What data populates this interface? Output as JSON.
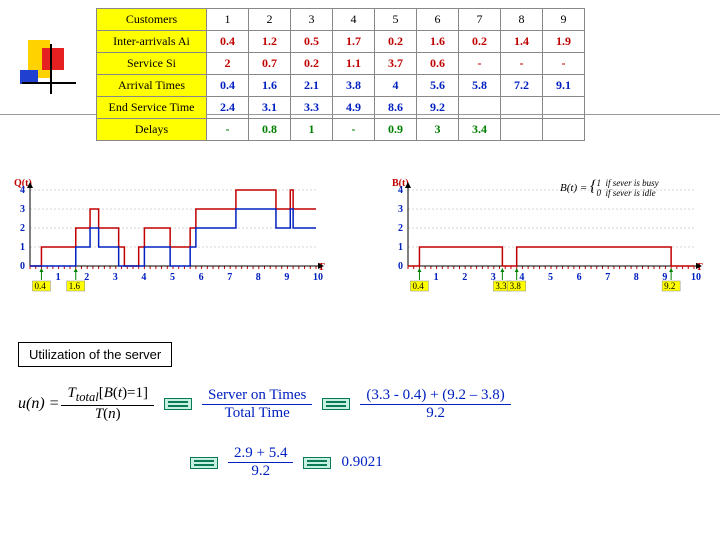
{
  "table": {
    "rows": [
      {
        "h": "Customers",
        "cls": "",
        "v": [
          "1",
          "2",
          "3",
          "4",
          "5",
          "6",
          "7",
          "8",
          "9"
        ]
      },
      {
        "h": "Inter-arrivals Ai",
        "cls": "red",
        "v": [
          "0.4",
          "1.2",
          "0.5",
          "1.7",
          "0.2",
          "1.6",
          "0.2",
          "1.4",
          "1.9"
        ]
      },
      {
        "h": "Service Si",
        "cls": "red",
        "v": [
          "2",
          "0.7",
          "0.2",
          "1.1",
          "3.7",
          "0.6",
          "-",
          "-",
          "-"
        ]
      },
      {
        "h": "Arrival Times",
        "cls": "blue",
        "v": [
          "0.4",
          "1.6",
          "2.1",
          "3.8",
          "4",
          "5.6",
          "5.8",
          "7.2",
          "9.1"
        ]
      },
      {
        "h": "End Service Time",
        "cls": "blue",
        "v": [
          "2.4",
          "3.1",
          "3.3",
          "4.9",
          "8.6",
          "9.2",
          "",
          "",
          ""
        ]
      },
      {
        "h": "Delays",
        "cls": "grn",
        "v": [
          "-",
          "0.8",
          "1",
          "-",
          "0.9",
          "3",
          "3.4",
          "",
          ""
        ]
      }
    ]
  },
  "chart_data": [
    {
      "type": "line",
      "title": "Q(t)",
      "xlabel": "T",
      "ylim": [
        0,
        4
      ],
      "xlim": [
        0,
        10
      ],
      "annotations": [
        "0.4",
        "1.6"
      ],
      "series": [
        {
          "name": "red",
          "color": "#c00000",
          "points": [
            [
              0,
              0
            ],
            [
              0.4,
              0
            ],
            [
              0.4,
              1
            ],
            [
              1.6,
              1
            ],
            [
              1.6,
              2
            ],
            [
              2.1,
              2
            ],
            [
              2.1,
              3
            ],
            [
              2.4,
              3
            ],
            [
              2.4,
              2
            ],
            [
              3.1,
              2
            ],
            [
              3.1,
              1
            ],
            [
              3.3,
              1
            ],
            [
              3.3,
              0
            ],
            [
              3.8,
              0
            ],
            [
              3.8,
              1
            ],
            [
              4,
              1
            ],
            [
              4,
              2
            ],
            [
              4.9,
              2
            ],
            [
              4.9,
              1
            ],
            [
              5.6,
              1
            ],
            [
              5.6,
              2
            ],
            [
              5.8,
              2
            ],
            [
              5.8,
              3
            ],
            [
              7.2,
              3
            ],
            [
              7.2,
              4
            ],
            [
              8.6,
              4
            ],
            [
              8.6,
              3
            ],
            [
              9.1,
              3
            ],
            [
              9.1,
              4
            ],
            [
              9.2,
              4
            ],
            [
              9.2,
              3
            ],
            [
              10,
              3
            ]
          ]
        },
        {
          "name": "blue",
          "color": "#0020c0",
          "points": [
            [
              0,
              0
            ],
            [
              1.6,
              0
            ],
            [
              1.6,
              1
            ],
            [
              2.1,
              1
            ],
            [
              2.1,
              2
            ],
            [
              2.4,
              2
            ],
            [
              2.4,
              1
            ],
            [
              3.1,
              1
            ],
            [
              3.1,
              0
            ],
            [
              4,
              0
            ],
            [
              4,
              1
            ],
            [
              4.9,
              1
            ],
            [
              4.9,
              0
            ],
            [
              5.6,
              0
            ],
            [
              5.6,
              1
            ],
            [
              5.8,
              1
            ],
            [
              5.8,
              2
            ],
            [
              7.2,
              2
            ],
            [
              7.2,
              3
            ],
            [
              8.6,
              3
            ],
            [
              8.6,
              2
            ],
            [
              9.1,
              2
            ],
            [
              9.1,
              3
            ],
            [
              9.2,
              3
            ],
            [
              9.2,
              2
            ],
            [
              10,
              2
            ]
          ]
        }
      ]
    },
    {
      "type": "line",
      "title": "B(t)",
      "xlabel": "T",
      "ylim": [
        0,
        4
      ],
      "xlim": [
        0,
        10
      ],
      "annotations": [
        "0.4",
        "3.3",
        "3.8",
        "9.2"
      ],
      "definition": "B(t) = 1 if server is busy, 0 if server is idle",
      "series": [
        {
          "name": "red",
          "color": "#c00000",
          "points": [
            [
              0,
              0
            ],
            [
              0.4,
              0
            ],
            [
              0.4,
              1
            ],
            [
              3.3,
              1
            ],
            [
              3.3,
              0
            ],
            [
              3.8,
              0
            ],
            [
              3.8,
              1
            ],
            [
              9.2,
              1
            ],
            [
              9.2,
              0
            ],
            [
              10,
              0
            ]
          ]
        }
      ]
    }
  ],
  "util": {
    "label": "Utilization of the server"
  },
  "formula": {
    "lhs": "u(n) =",
    "f1num": "T",
    "f1sub": "total",
    "f1bkt": "[B(t) = 1]",
    "f1den": "T(n)",
    "f2num": "Server on Times",
    "f2den": "Total Time",
    "f3num": "(3.3 - 0.4) + (9.2 – 3.8)",
    "f3den": "9.2",
    "f4num": "2.9 + 5.4",
    "f4den": "9.2",
    "result": "0.9021"
  }
}
